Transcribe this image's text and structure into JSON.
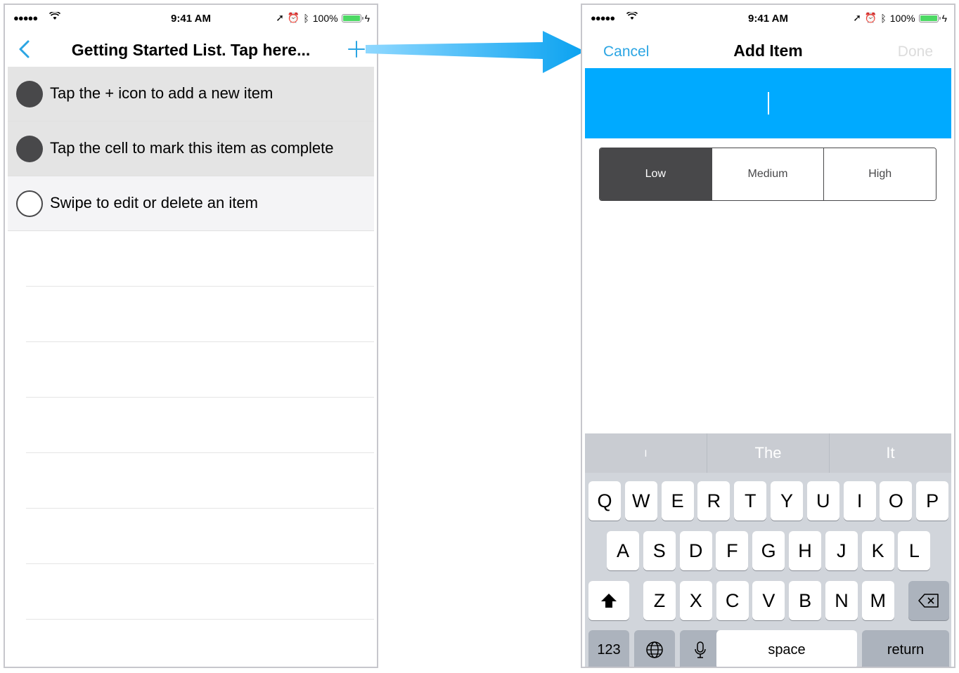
{
  "left_screen": {
    "status": {
      "signal": "●●●●●",
      "time": "9:41 AM",
      "battery": "100%"
    },
    "nav": {
      "title": "Getting Started List. Tap here..."
    },
    "items": [
      {
        "label": "Tap the + icon to add a new item",
        "completed": true
      },
      {
        "label": "Tap the cell to mark this item as complete",
        "completed": true
      },
      {
        "label": "Swipe to edit or delete an item",
        "completed": false
      }
    ]
  },
  "right_screen": {
    "status": {
      "signal": "●●●●●",
      "time": "9:41 AM",
      "battery": "100%"
    },
    "nav": {
      "cancel": "Cancel",
      "title": "Add Item",
      "done": "Done"
    },
    "input": {
      "value": ""
    },
    "priority": {
      "options": [
        "Low",
        "Medium",
        "High"
      ],
      "selected": "Low"
    },
    "keyboard": {
      "suggestions": [
        "I",
        "The",
        "It"
      ],
      "row1": [
        "Q",
        "W",
        "E",
        "R",
        "T",
        "Y",
        "U",
        "I",
        "O",
        "P"
      ],
      "row2": [
        "A",
        "S",
        "D",
        "F",
        "G",
        "H",
        "J",
        "K",
        "L"
      ],
      "row3": [
        "Z",
        "X",
        "C",
        "V",
        "B",
        "N",
        "M"
      ],
      "numbers_key": "123",
      "space_key": "space",
      "return_key": "return"
    }
  },
  "colors": {
    "accent": "#2ba5e3",
    "input_band": "#00aaff",
    "dark_gray": "#48484a",
    "battery": "#4cd964"
  }
}
